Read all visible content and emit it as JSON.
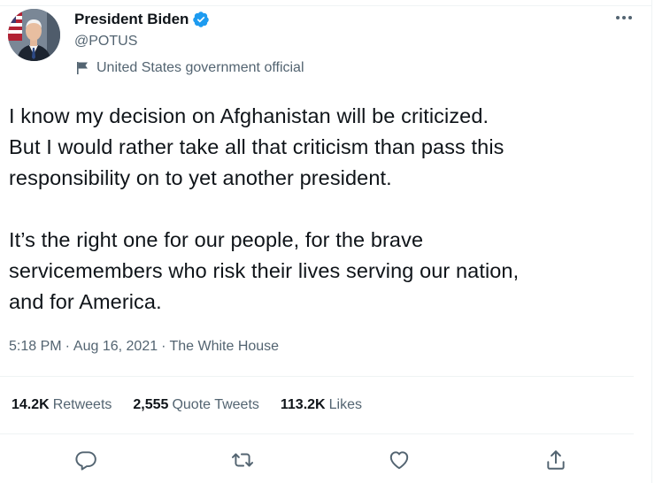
{
  "author": {
    "name": "President Biden",
    "handle": "@POTUS",
    "label": "United States government official"
  },
  "tweet": {
    "paragraph1": "I know my decision on Afghanistan will be criticized.\nBut I would rather take all that criticism than pass this\nresponsibility on to yet another president.",
    "paragraph2": "It’s the right one for our people, for the brave\nservicemembers who risk their lives serving our nation,\nand for America."
  },
  "meta": {
    "time": "5:18 PM",
    "date": "Aug 16, 2021",
    "source": "The White House",
    "separator": "·"
  },
  "stats": {
    "retweets_count": "14.2K",
    "retweets_label": "Retweets",
    "quotes_count": "2,555",
    "quotes_label": "Quote Tweets",
    "likes_count": "113.2K",
    "likes_label": "Likes"
  },
  "icons": {
    "verified": "verified-badge-icon",
    "more": "more-options-icon",
    "flag": "government-flag-icon",
    "reply": "reply-icon",
    "retweet": "retweet-icon",
    "like": "like-icon",
    "share": "share-icon"
  },
  "colors": {
    "verified": "#1d9bf0",
    "text_primary": "#0f1419",
    "text_secondary": "#536471",
    "divider": "#eff3f4"
  }
}
